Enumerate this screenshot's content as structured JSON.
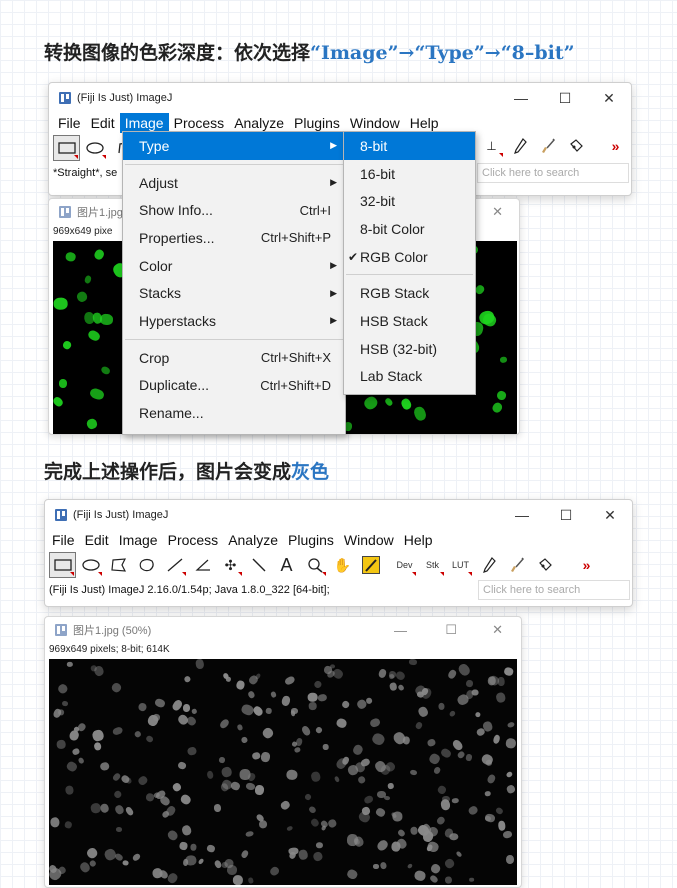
{
  "heading1": {
    "prefix": "转换图像的色彩深度：依次选择",
    "highlight": "“Image”→“Type”→“8–bit”"
  },
  "heading2": {
    "prefix": "完成上述操作后，图片会变成",
    "highlight": "灰色"
  },
  "window1": {
    "title": "(Fiji Is Just) ImageJ",
    "menus": [
      "File",
      "Edit",
      "Image",
      "Process",
      "Analyze",
      "Plugins",
      "Window",
      "Help"
    ],
    "active_menu": "Image",
    "status_text": "*Straight*, se",
    "search_placeholder": "Click here to search",
    "image_window": {
      "title": "图片1.jpg",
      "info": "969x649 pixe"
    }
  },
  "image_menu": {
    "items": [
      {
        "label": "Type",
        "submenu": true,
        "highlighted": true
      },
      {
        "label": "Adjust",
        "submenu": true
      },
      {
        "label": "Show Info...",
        "shortcut": "Ctrl+I"
      },
      {
        "label": "Properties...",
        "shortcut": "Ctrl+Shift+P"
      },
      {
        "label": "Color",
        "submenu": true
      },
      {
        "label": "Stacks",
        "submenu": true
      },
      {
        "label": "Hyperstacks",
        "submenu": true
      },
      {
        "label": "Crop",
        "shortcut": "Ctrl+Shift+X"
      },
      {
        "label": "Duplicate...",
        "shortcut": "Ctrl+Shift+D"
      },
      {
        "label": "Rename..."
      }
    ]
  },
  "type_submenu": {
    "items": [
      "8-bit",
      "16-bit",
      "32-bit",
      "8-bit Color",
      "RGB Color",
      "RGB Stack",
      "HSB Stack",
      "HSB (32-bit)",
      "Lab Stack"
    ],
    "highlighted": "8-bit",
    "checked": "RGB Color"
  },
  "window2": {
    "title": "(Fiji Is Just) ImageJ",
    "menus": [
      "File",
      "Edit",
      "Image",
      "Process",
      "Analyze",
      "Plugins",
      "Window",
      "Help"
    ],
    "toolbar_text_buttons": [
      "Dev",
      "Stk",
      "LUT"
    ],
    "status_text": "(Fiji Is Just) ImageJ 2.16.0/1.54p; Java 1.8.0_322 [64-bit];",
    "search_placeholder": "Click here to search",
    "image_window": {
      "title": "图片1.jpg (50%)",
      "info": "969x649 pixels; 8-bit; 614K"
    }
  },
  "colors": {
    "accent": "#0078d7",
    "heading_highlight": "#2b76c2",
    "fluorescence": "#1fd61f",
    "gray_cells": "#8a8a8a"
  }
}
